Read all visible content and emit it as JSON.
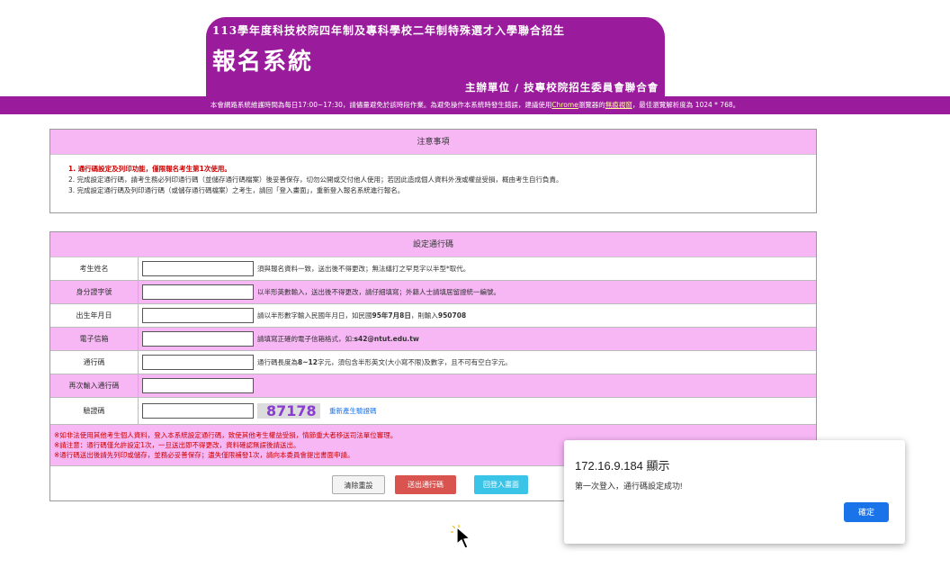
{
  "header": {
    "subtitle": "113學年度科技校院四年制及專科學校二年制特殊選才入學聯合招生",
    "title": "報名系統",
    "organizer": "主辦單位 / 技專校院招生委員會聯合會"
  },
  "notice_bar": {
    "text_before": "本會網路系統維護時間為每日17:00~17:30，請儘量避免於該時段作業。為避免操作本系統時發生錯誤，建議使用",
    "chrome_link": "Chrome",
    "text_mid": "瀏覽器的",
    "incognito_link": "無痕視窗",
    "text_after": "，最佳瀏覽解析度為 1024 * 768。"
  },
  "notes": {
    "heading": "注意事項",
    "item1": "1. 通行碼設定及列印功能，僅限報名考生第1次使用。",
    "item2": "2. 完成設定通行碼，請考生務必列印通行碼（並儲存通行碼檔案）後妥善保存，切勿公開或交付他人使用；若因此造成個人資料外洩或權益受損，概由考生自行負責。",
    "item3": "3. 完成設定通行碼及列印通行碼（或儲存通行碼檔案）之考生，請回「登入畫面」，重新登入報名系統進行報名。"
  },
  "form": {
    "heading": "設定通行碼",
    "name_label": "考生姓名",
    "name_hint": "須與報名資料一致，送出後不得更改；無法繕打之罕見字以半型*取代。",
    "id_label": "身分證字號",
    "id_hint": "以半形英數輸入，送出後不得更改，請仔細填寫；外籍人士請填居留證統一編號。",
    "birth_label": "出生年月日",
    "birth_hint_pre": "請以半形數字輸入民國年月日，如民國",
    "birth_hint_ex1": "95年7月8日",
    "birth_hint_mid": "，則輸入",
    "birth_hint_ex2": "950708",
    "email_label": "電子信箱",
    "email_hint_pre": "請填寫正確的電子信箱格式，如:",
    "email_hint_ex": "s42@ntut.edu.tw",
    "pass_label": "通行碼",
    "pass_hint_pre": "通行碼長度為",
    "pass_hint_len": "8~12",
    "pass_hint_post": "字元，須包含半形英文(大小寫不限)及數字，且不可有空白字元。",
    "repass_label": "再次輸入通行碼",
    "captcha_label": "驗證碼",
    "captcha_code": "87178",
    "captcha_regen": "重新產生驗證碼",
    "warn1": "※如非法使用其他考生個人資料，登入本系統設定通行碼，致使其他考生權益受損，情節重大者移送司法單位審理。",
    "warn2": "※請注意：通行碼僅允許設定1次，一旦送出即不得更改，資料確認無誤後請送出。",
    "warn3": "※通行碼送出後請先列印或儲存，並務必妥善保存；遺失僅限補發1次，請向本委員會提出書面申請。",
    "clear_btn": "清除重設",
    "submit_btn": "送出通行碼",
    "back_btn": "回登入畫面"
  },
  "dialog": {
    "title": "172.16.9.184 顯示",
    "message": "第一次登入，通行碼設定成功!",
    "ok": "確定"
  },
  "colors": {
    "brand": "#9a1b9b",
    "pink": "#f7b7f5",
    "submit": "#d9534f",
    "back": "#3ac4e8",
    "ok": "#1a73e8"
  }
}
